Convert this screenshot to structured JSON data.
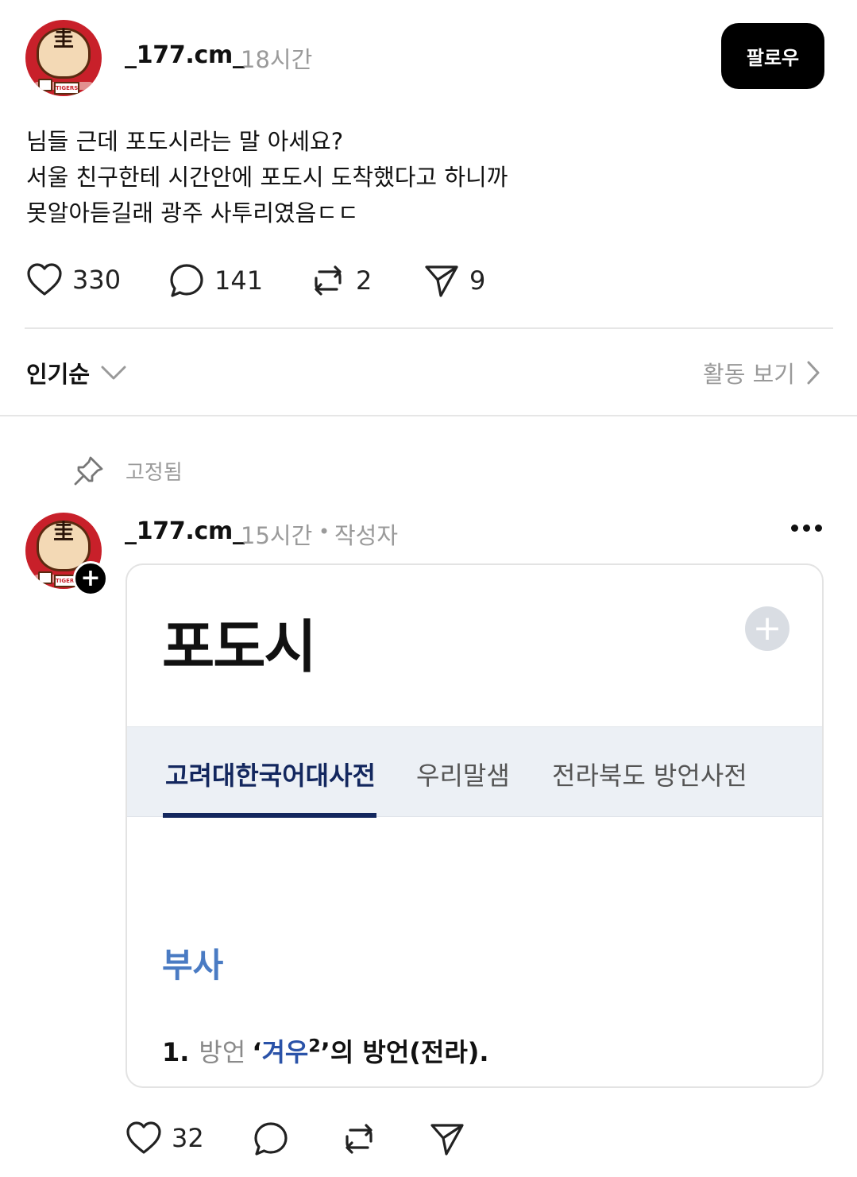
{
  "post": {
    "username": "_177.cm_",
    "time": "18시간",
    "follow_label": "팔로우",
    "text_lines": [
      "님들 근데 포도시라는 말 아세요?",
      "서울 친구한테 시간안에 포도시 도착했다고 하니까",
      "못알아듣길래 광주 사투리였음ㄷㄷ"
    ],
    "likes": "330",
    "replies": "141",
    "reposts": "2",
    "shares": "9"
  },
  "sort": {
    "label": "인기순",
    "activity_label": "활동 보기"
  },
  "reply": {
    "pinned_label": "고정됨",
    "username": "_177.cm_",
    "time": "15시간",
    "separator": "•",
    "author_tag": "작성자",
    "likes": "32",
    "card": {
      "headword": "포도시",
      "tabs": [
        "고려대한국어대사전",
        "우리말샘",
        "전라북도 방언사전"
      ],
      "pos": "부사",
      "def_num": "1.",
      "def_label": "방언",
      "def_open": "‘",
      "def_word": "겨우",
      "def_sup": "2",
      "def_rest": "’의 방언(전라)."
    }
  },
  "avatar_badge": "TIGERS",
  "colors": {
    "accent_navy": "#13275e",
    "pos_blue": "#4a7bc3",
    "avatar_red": "#c8202a"
  }
}
